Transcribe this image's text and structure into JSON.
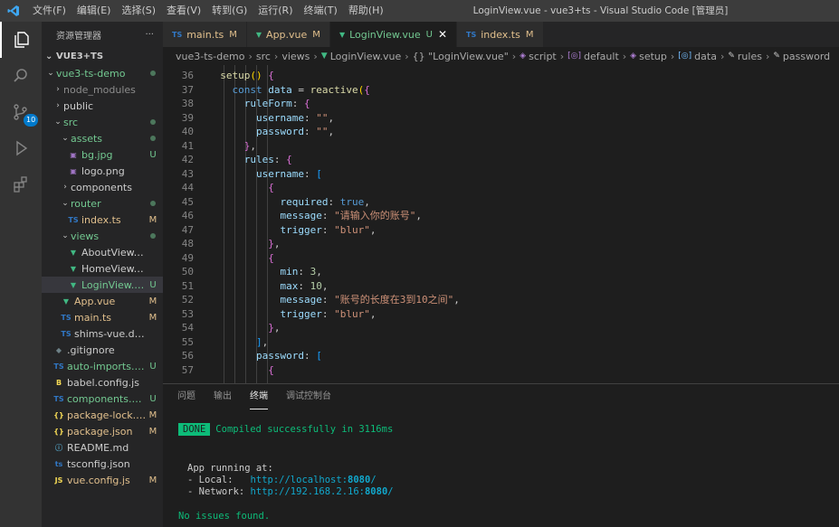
{
  "titlebar": {
    "menu": [
      "文件(F)",
      "编辑(E)",
      "选择(S)",
      "查看(V)",
      "转到(G)",
      "运行(R)",
      "终端(T)",
      "帮助(H)"
    ],
    "title": "LoginView.vue - vue3+ts - Visual Studio Code [管理员]"
  },
  "activity": {
    "scm_badge": "10"
  },
  "sidebar": {
    "header": "资源管理器",
    "more": "···",
    "section": "VUE3+TS",
    "items": [
      {
        "label": "vue3-ts-demo",
        "status": "dot"
      },
      {
        "label": "node_modules",
        "status": ""
      },
      {
        "label": "public",
        "status": ""
      },
      {
        "label": "src",
        "status": "dot"
      },
      {
        "label": "assets",
        "status": "dot"
      },
      {
        "label": "bg.jpg",
        "status": "U"
      },
      {
        "label": "logo.png",
        "status": ""
      },
      {
        "label": "components",
        "status": ""
      },
      {
        "label": "router",
        "status": "dot"
      },
      {
        "label": "index.ts",
        "status": "M"
      },
      {
        "label": "views",
        "status": "dot"
      },
      {
        "label": "AboutView.vue",
        "status": ""
      },
      {
        "label": "HomeView.vue",
        "status": ""
      },
      {
        "label": "LoginView.vue",
        "status": "U"
      },
      {
        "label": "App.vue",
        "status": "M"
      },
      {
        "label": "main.ts",
        "status": "M"
      },
      {
        "label": "shims-vue.d.ts",
        "status": ""
      },
      {
        "label": ".gitignore",
        "status": ""
      },
      {
        "label": "auto-imports.d.ts",
        "status": "U"
      },
      {
        "label": "babel.config.js",
        "status": ""
      },
      {
        "label": "components.d.ts",
        "status": "U"
      },
      {
        "label": "package-lock.j...",
        "status": "M"
      },
      {
        "label": "package.json",
        "status": "M"
      },
      {
        "label": "README.md",
        "status": ""
      },
      {
        "label": "tsconfig.json",
        "status": ""
      },
      {
        "label": "vue.config.js",
        "status": "M"
      }
    ]
  },
  "tabs": [
    {
      "icon": "TS",
      "label": "main.ts",
      "status": "M"
    },
    {
      "icon": "▼",
      "label": "App.vue",
      "status": "M"
    },
    {
      "icon": "▼",
      "label": "LoginView.vue",
      "status": "U",
      "close": "✕"
    },
    {
      "icon": "TS",
      "label": "index.ts",
      "status": "M"
    }
  ],
  "breadcrumb": [
    "vue3-ts-demo",
    "src",
    "views",
    "LoginView.vue",
    "{} \"LoginView.vue\"",
    "script",
    "default",
    "setup",
    "data",
    "rules",
    "password"
  ],
  "editor": {
    "lines": [
      {
        "n": "36",
        "t": "  setup() {"
      },
      {
        "n": "37",
        "t": "    const data = reactive({"
      },
      {
        "n": "38",
        "t": "      ruleForm: {"
      },
      {
        "n": "39",
        "t": "        username: \"\","
      },
      {
        "n": "40",
        "t": "        password: \"\","
      },
      {
        "n": "41",
        "t": "      },"
      },
      {
        "n": "42",
        "t": "      rules: {"
      },
      {
        "n": "43",
        "t": "        username: ["
      },
      {
        "n": "44",
        "t": "          {"
      },
      {
        "n": "45",
        "t": "            required: true,"
      },
      {
        "n": "46",
        "t": "            message: \"请输入你的账号\","
      },
      {
        "n": "47",
        "t": "            trigger: \"blur\","
      },
      {
        "n": "48",
        "t": "          },"
      },
      {
        "n": "49",
        "t": "          {"
      },
      {
        "n": "50",
        "t": "            min: 3,"
      },
      {
        "n": "51",
        "t": "            max: 10,"
      },
      {
        "n": "52",
        "t": "            message: \"账号的长度在3到10之间\","
      },
      {
        "n": "53",
        "t": "            trigger: \"blur\","
      },
      {
        "n": "54",
        "t": "          },"
      },
      {
        "n": "55",
        "t": "        ],"
      },
      {
        "n": "56",
        "t": "        password: ["
      },
      {
        "n": "57",
        "t": "          {"
      }
    ]
  },
  "panel": {
    "tabs": [
      "问题",
      "输出",
      "终端",
      "调试控制台"
    ],
    "done": "DONE",
    "compiled": "Compiled successfully in 3116ms",
    "app_running": "App running at:",
    "local_label": "- Local:   ",
    "local_url": "http://localhost:",
    "local_port": "8080",
    "network_label": "- Network: ",
    "network_url": "http://192.168.2.16:",
    "network_port": "8080",
    "slash": "/",
    "no_issues": "No issues found."
  },
  "colors": {
    "accent": "#007acc",
    "git_untracked": "#73c991",
    "git_modified": "#e2c08d",
    "vue_green": "#41b883",
    "ts_blue": "#3178c6"
  }
}
